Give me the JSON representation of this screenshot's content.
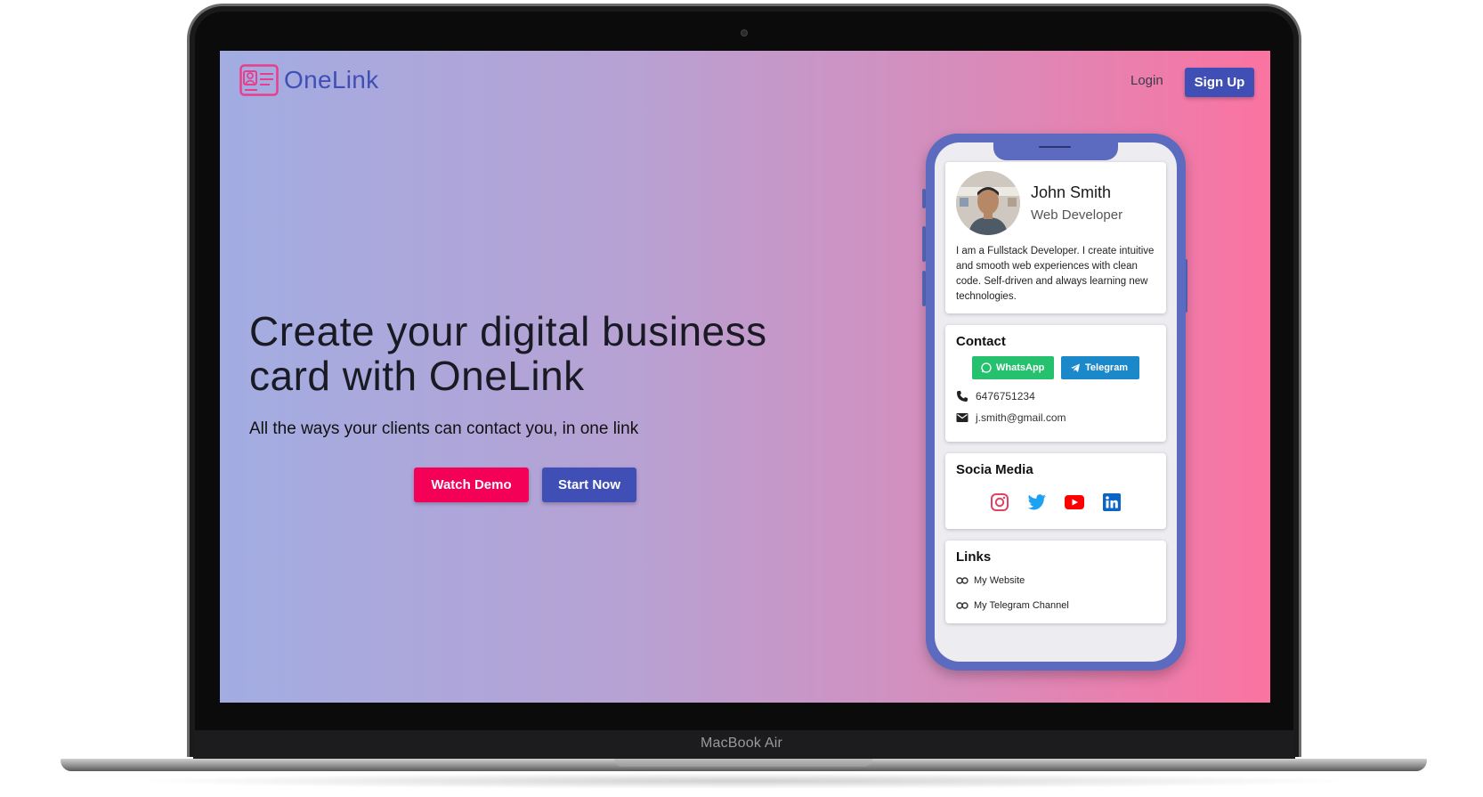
{
  "device": {
    "label": "MacBook Air"
  },
  "app": {
    "logo_text": "OneLink",
    "nav": {
      "login_label": "Login",
      "signup_label": "Sign Up"
    },
    "colors": {
      "primary": "#3f4fb5",
      "accent": "#f50057",
      "gradient_start": "#a2ade2",
      "gradient_end": "#fb73a1"
    }
  },
  "hero": {
    "title": "Create your digital business card with OneLink",
    "subtitle": "All the ways your clients can contact you, in one link",
    "watch_demo_label": "Watch Demo",
    "start_now_label": "Start Now"
  },
  "profile_card": {
    "name": "John Smith",
    "role": "Web Developer",
    "bio": "I am a Fullstack Developer. I create intuitive and smooth web experiences with clean code. Self-driven and always learning new technologies."
  },
  "contact": {
    "heading": "Contact",
    "whatsapp_label": "WhatsApp",
    "telegram_label": "Telegram",
    "phone": "6476751234",
    "email": "j.smith@gmail.com"
  },
  "social": {
    "heading": "Socia Media",
    "icons": [
      "instagram-icon",
      "twitter-icon",
      "youtube-icon",
      "linkedin-icon"
    ]
  },
  "links": {
    "heading": "Links",
    "items": [
      "My Website",
      "My Telegram Channel"
    ]
  }
}
